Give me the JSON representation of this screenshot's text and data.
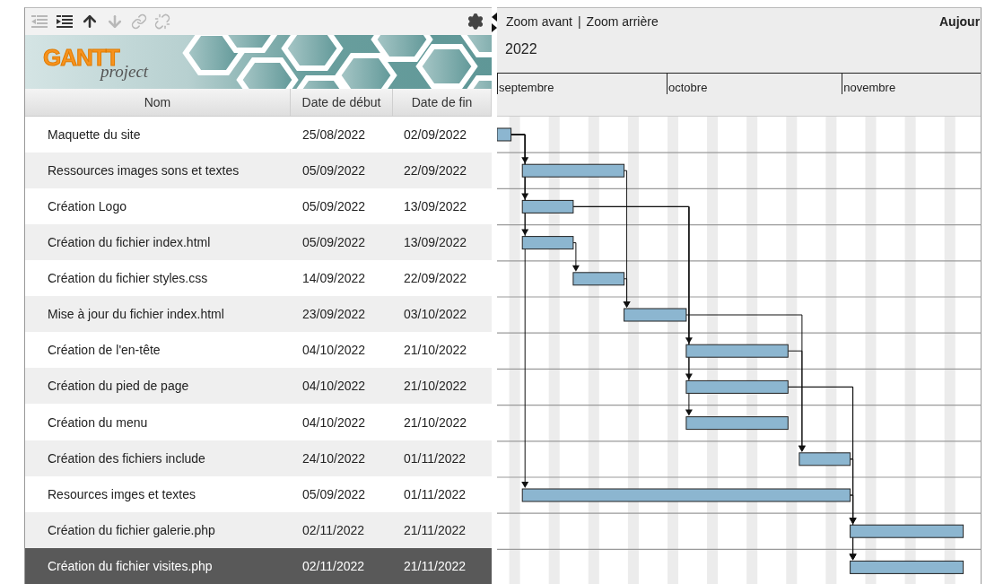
{
  "toolbar": [
    {
      "kind": "unindent",
      "disabled": true
    },
    {
      "kind": "indent",
      "disabled": false
    },
    {
      "kind": "up",
      "disabled": false
    },
    {
      "kind": "down",
      "disabled": true
    },
    {
      "kind": "link",
      "disabled": true
    },
    {
      "kind": "unlink",
      "disabled": true
    }
  ],
  "logo": {
    "word": "GANTT",
    "subtitle": "project"
  },
  "columns": [
    "Nom",
    "Date de début",
    "Date de fin"
  ],
  "tasks": [
    {
      "name": "Maquette du site",
      "start": "25/08/2022",
      "end": "02/09/2022",
      "selected": false
    },
    {
      "name": "Ressources images sons et textes",
      "start": "05/09/2022",
      "end": "22/09/2022",
      "selected": false
    },
    {
      "name": "Création Logo",
      "start": "05/09/2022",
      "end": "13/09/2022",
      "selected": false
    },
    {
      "name": "Création du fichier index.html",
      "start": "05/09/2022",
      "end": "13/09/2022",
      "selected": false
    },
    {
      "name": "Création du fichier styles.css",
      "start": "14/09/2022",
      "end": "22/09/2022",
      "selected": false
    },
    {
      "name": "Mise à jour du fichier index.html",
      "start": "23/09/2022",
      "end": "03/10/2022",
      "selected": false
    },
    {
      "name": "Création de l'en-tête",
      "start": "04/10/2022",
      "end": "21/10/2022",
      "selected": false
    },
    {
      "name": "Création du pied de page",
      "start": "04/10/2022",
      "end": "21/10/2022",
      "selected": false
    },
    {
      "name": "Création du menu",
      "start": "04/10/2022",
      "end": "21/10/2022",
      "selected": false
    },
    {
      "name": "Création des fichiers include",
      "start": "24/10/2022",
      "end": "01/11/2022",
      "selected": false
    },
    {
      "name": "Resources imges et textes",
      "start": "05/09/2022",
      "end": "01/11/2022",
      "selected": false
    },
    {
      "name": "Création du fichier galerie.php",
      "start": "02/11/2022",
      "end": "21/11/2022",
      "selected": false
    },
    {
      "name": "Création du fichier visites.php",
      "start": "02/11/2022",
      "end": "21/11/2022",
      "selected": true
    }
  ],
  "chart_header": {
    "zoom_in": "Zoom avant",
    "separator": "|",
    "zoom_out": "Zoom arrière",
    "today": "Aujour"
  },
  "timeline": {
    "year": "2022",
    "months": [
      "septembre",
      "octobre",
      "novembre"
    ]
  }
}
